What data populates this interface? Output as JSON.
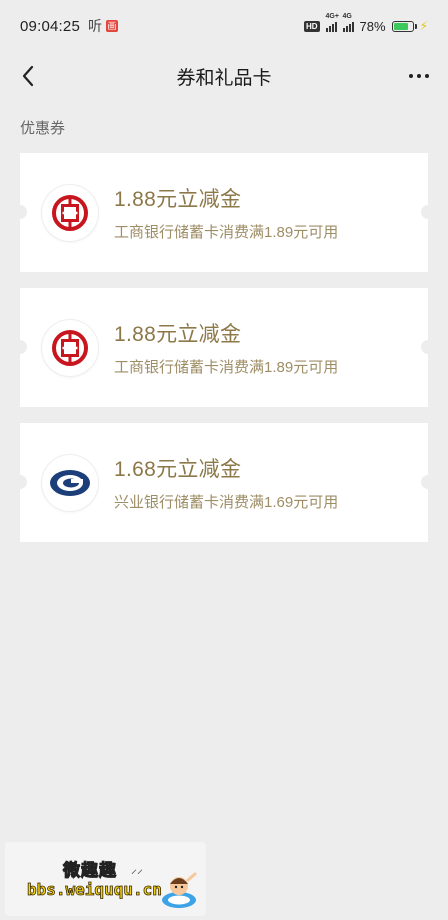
{
  "status_bar": {
    "time": "09:04:25",
    "app_glyph": "听",
    "app_badge": "画",
    "hd_label": "HD",
    "signal1_label": "4G+",
    "signal2_label": "4G",
    "battery_pct": "78%",
    "battery_level": 0.78,
    "icons": [
      "hd-icon",
      "signal-icon",
      "battery-icon",
      "charging-bolt-icon"
    ]
  },
  "nav": {
    "title": "券和礼品卡",
    "back_icon": "back-chevron-icon",
    "more_icon": "more-dots-icon"
  },
  "section_label": "优惠券",
  "coupons": [
    {
      "amount": "1.88元立减金",
      "condition": "工商银行储蓄卡消费满1.89元可用",
      "logo": "icbc-logo-icon"
    },
    {
      "amount": "1.88元立减金",
      "condition": "工商银行储蓄卡消费满1.89元可用",
      "logo": "icbc-logo-icon"
    },
    {
      "amount": "1.68元立减金",
      "condition": "兴业银行储蓄卡消费满1.69元可用",
      "logo": "cib-logo-icon"
    }
  ],
  "colors": {
    "page_bg": "#ededed",
    "card_bg": "#ffffff",
    "amount_text": "#8c7848",
    "condition_text": "#9e8e66",
    "icbc_red": "#c7161e",
    "cib_navy": "#1c3f7a"
  },
  "watermark": {
    "title": "微趣趣",
    "url": "bbs.weiququ.cn",
    "mascot_icon": "mascot-icon"
  }
}
